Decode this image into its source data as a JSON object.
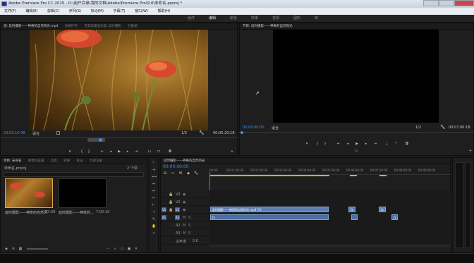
{
  "window": {
    "title": "Adobe Premiere Pro CC 2015 - D:\\用户目录\\我的文档\\Adobe\\Premiere Pro\\9.0\\未命名.prproj *"
  },
  "menu": [
    "文件(F)",
    "编辑(E)",
    "剪辑(C)",
    "序列(S)",
    "标记(M)",
    "字幕(T)",
    "窗口(W)",
    "帮助(H)"
  ],
  "workspaces": [
    "组件",
    "编辑",
    "颜色",
    "效果",
    "音频",
    "图形",
    "库"
  ],
  "source_panel": {
    "tabs": [
      "源: 延时摄影——神奇的自然风光.mp4",
      "效果控件",
      "音频剪辑混合器: 延时摄影",
      "元数据"
    ],
    "timecode_left": "00:02:10:08",
    "fit": "适合",
    "ratio": "1/2",
    "timecode_right": "00:05:20:18"
  },
  "program_panel": {
    "tabs": [
      "节目: 延时摄影——神奇的自然风光"
    ],
    "timecode_left": "00:00:00:00",
    "fit": "适合",
    "ratio": "1/2",
    "timecode_right": "00:07:00:18"
  },
  "project_panel": {
    "tabs": [
      "项目: 未命名",
      "媒体浏览器",
      "信息",
      "效果",
      "标记",
      "历史记录"
    ],
    "project_file": "未命名.prproj",
    "count": "2 个项",
    "items": [
      {
        "name": "延时摄影——神奇的自然风光",
        "duration": "25:08"
      },
      {
        "name": "延时摄影——神奇的...",
        "duration": "7:00:18"
      }
    ]
  },
  "timeline": {
    "tab": "延时摄影——神奇的自然风光",
    "timecode": "00:00:00:00",
    "ruler": [
      "00:00",
      "00:01:00:00",
      "00:02:00:00",
      "00:03:00:00",
      "00:04:00:00",
      "00:05:00:00",
      "00:06:00:00",
      "00:07:00:00",
      "00:08:00:00",
      "00:09:00:00"
    ],
    "video_tracks": [
      "V3",
      "V2",
      "V1"
    ],
    "audio_tracks": [
      "A1",
      "A2",
      "A3"
    ],
    "master": "主声道",
    "master_value": "0.0",
    "clips": {
      "v1_main": "延时摄影——神奇的自然风光.mp4 [V]",
      "a1_main": "fx",
      "small_1": "fx",
      "small_2": "fx",
      "small_3": "fx"
    }
  },
  "colors": {
    "timecode": "#3b8ee6",
    "clip": "#5a7fb5"
  }
}
